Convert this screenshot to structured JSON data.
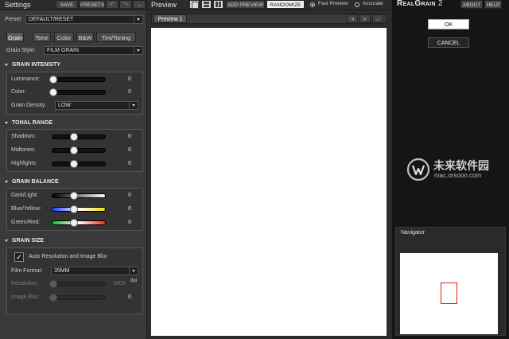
{
  "settings": {
    "title": "Settings",
    "save_label": "SAVE",
    "presets_label": "PRESETS",
    "preset_label": "Preset",
    "preset_value": "DEFAULT/RESET"
  },
  "tabs": [
    {
      "label": "Grain",
      "active": true
    },
    {
      "label": "Tone"
    },
    {
      "label": "Color"
    },
    {
      "label": "B&W"
    },
    {
      "label": "Tint/Toning"
    }
  ],
  "grain_style": {
    "label": "Grain Style:",
    "value": "FILM GRAIN"
  },
  "grain_intensity": {
    "heading": "GRAIN INTENSITY",
    "luminance": {
      "label": "Luminance:",
      "value": "0",
      "level": 0
    },
    "color": {
      "label": "Color:",
      "value": "0",
      "level": 0
    },
    "density": {
      "label": "Grain Density:",
      "value": "LOW"
    }
  },
  "tonal_range": {
    "heading": "TONAL RANGE",
    "shadows": {
      "label": "Shadows:",
      "value": "0",
      "level": 0.5
    },
    "midtones": {
      "label": "Midtones:",
      "value": "0",
      "level": 0.5
    },
    "highlights": {
      "label": "Highlights:",
      "value": "0",
      "level": 0.5
    }
  },
  "grain_balance": {
    "heading": "GRAIN BALANCE",
    "dark_light": {
      "label": "Dark/Light:",
      "value": "0",
      "level": 0.5
    },
    "blue_yellow": {
      "label": "Blue/Yellow:",
      "value": "0",
      "level": 0.5
    },
    "green_red": {
      "label": "Green/Red:",
      "value": "0",
      "level": 0.5
    }
  },
  "grain_size": {
    "heading": "GRAIN SIZE",
    "auto_label": "Auto Resolution and Image Blur",
    "auto_checked": true,
    "film_format_label": "Film Format:",
    "film_format_value": "35MM",
    "resolution_label": "Resolution:",
    "resolution_value": "1800",
    "resolution_unit": "dpi",
    "image_blur_label": "Image Blur:",
    "image_blur_value": "0"
  },
  "preview": {
    "title": "Preview",
    "add_preview_label": "ADD PREVIEW",
    "randomize_label": "RANDOMIZE",
    "fast_preview_label": "Fast Preview",
    "accurate_label": "Accurate",
    "fast_preview_selected": true,
    "tab_label": "Preview 1"
  },
  "right": {
    "logo_text": "RealGrain",
    "logo_version": "2",
    "about_label": "ABOUT",
    "help_label": "HELP",
    "ok_label": "OK",
    "cancel_label": "CANCEL",
    "watermark_text": "未来软件园",
    "watermark_url": "mac.orsoon.com",
    "navigator_title": "Navigator"
  },
  "colors": {
    "accent_red": "#e31b1b"
  }
}
